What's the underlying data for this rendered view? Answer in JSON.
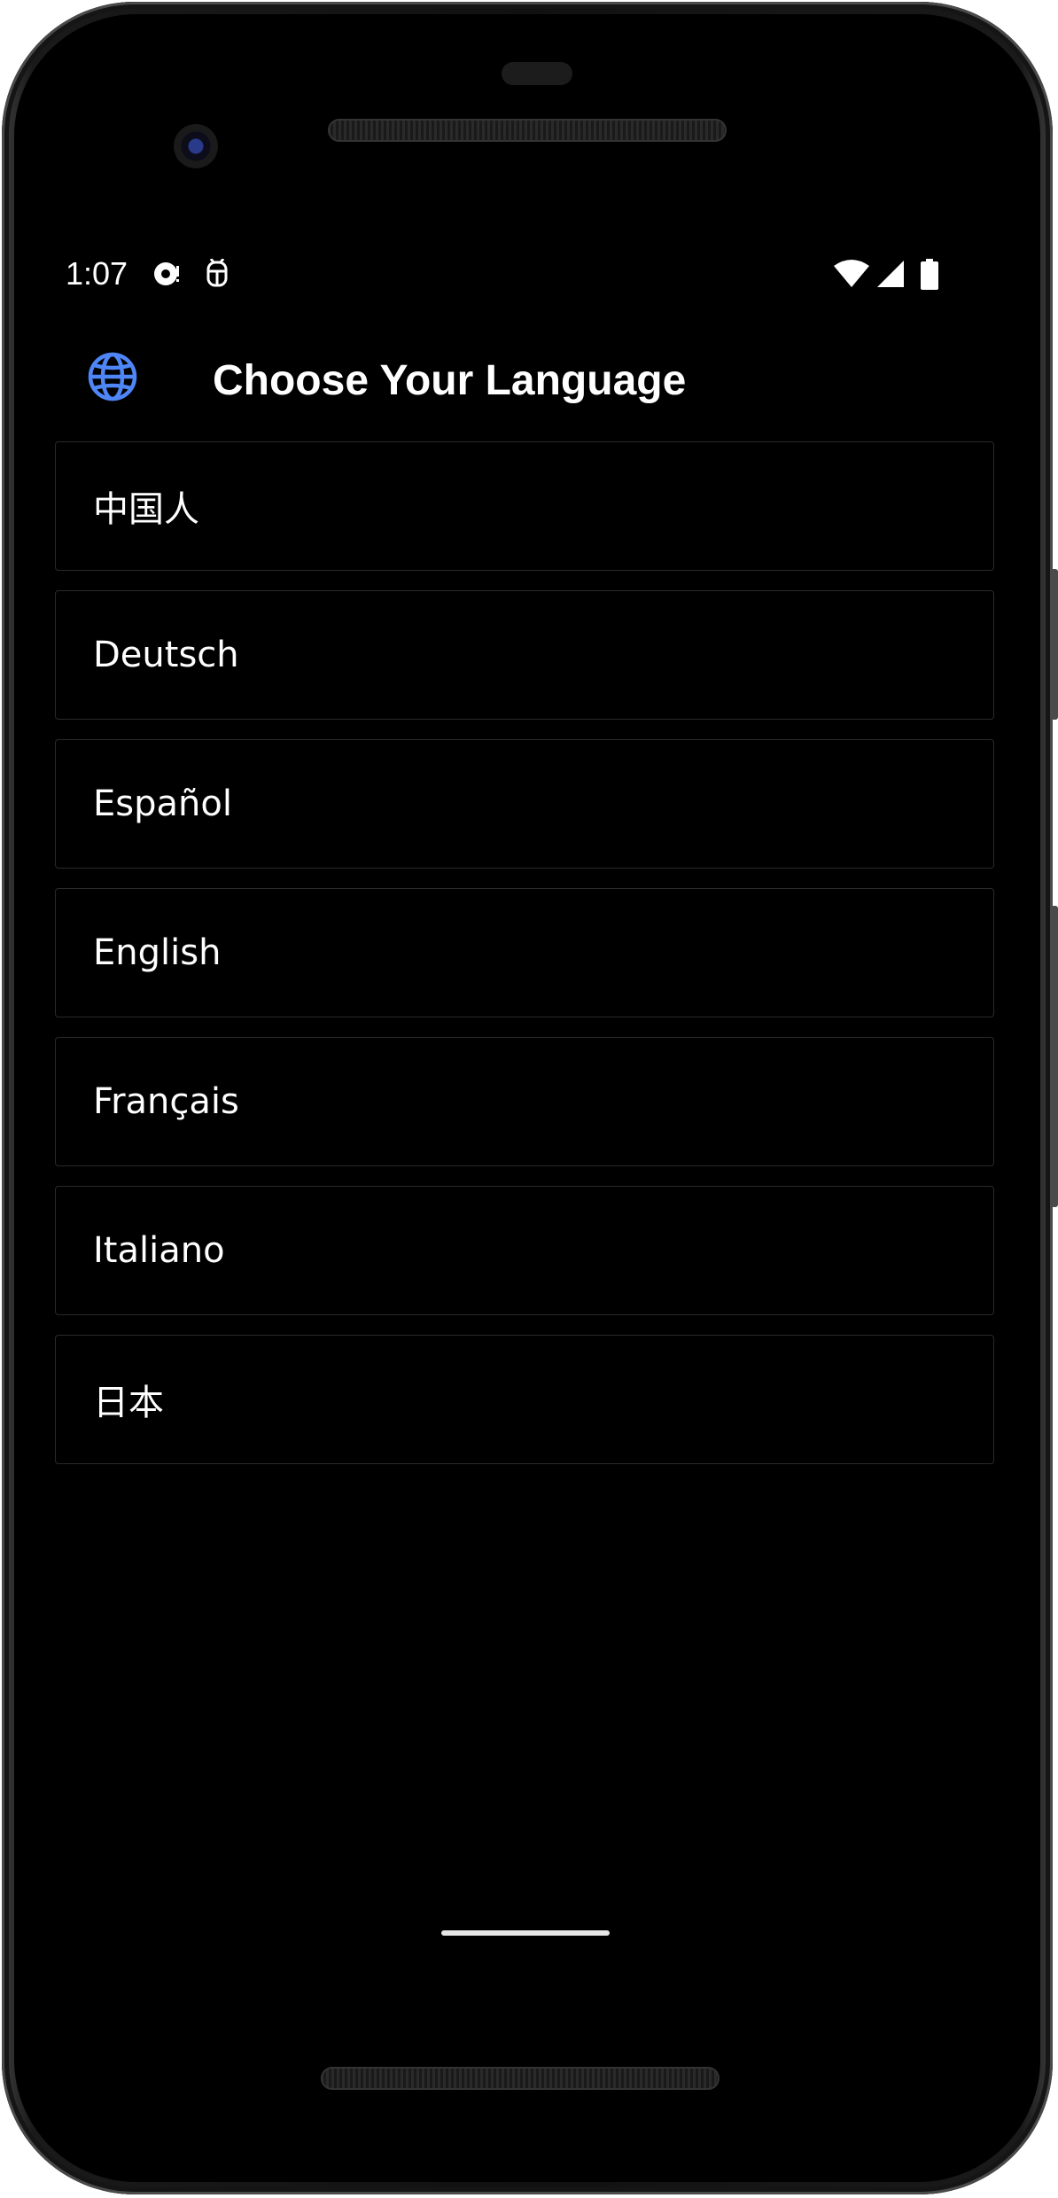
{
  "status_bar": {
    "time": "1:07",
    "icons": [
      "sync-notification-icon",
      "debug-notification-icon",
      "wifi-icon",
      "signal-icon",
      "battery-icon"
    ]
  },
  "app_bar": {
    "icon": "globe-icon",
    "title": "Choose Your Language"
  },
  "languages": [
    {
      "label": "中国人"
    },
    {
      "label": "Deutsch"
    },
    {
      "label": "Español"
    },
    {
      "label": "English"
    },
    {
      "label": "Français"
    },
    {
      "label": "Italiano"
    },
    {
      "label": "日本"
    }
  ],
  "colors": {
    "background": "#000000",
    "text": "#ffffff",
    "accent": "#4f86f7",
    "item_border": "#2a2a2a"
  }
}
